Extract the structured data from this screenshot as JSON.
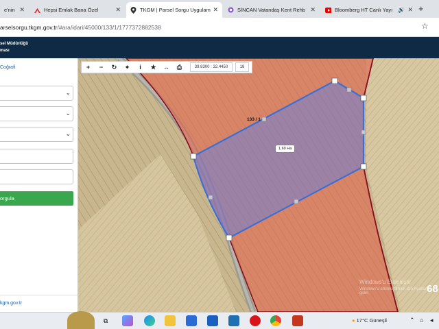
{
  "browser": {
    "tabs": [
      {
        "label": "e'nin",
        "icon": "globe-icon"
      },
      {
        "label": "Hepsi Emlak Bana Özel",
        "icon": "hepsiemlak-icon"
      },
      {
        "label": "TKGM | Parsel Sorgu Uygulam",
        "icon": "map-pin-icon",
        "active": true
      },
      {
        "label": "SİNCAN Vatandaş Kent Rehb",
        "icon": "globe-icon"
      },
      {
        "label": "Bloomberg HT Canlı Yayı",
        "icon": "youtube-icon"
      }
    ],
    "url_host": "arselsorgu.tkgm.gov.tr",
    "url_path": "/#ara/idari/45000/133/1/1777372882538"
  },
  "header": {
    "line1": "sel Müdürlüğü",
    "line2": "ması"
  },
  "panel": {
    "cografi_label": "Coğrafi",
    "query_button_label": "orgula",
    "footer_link": "kgm.gov.tr"
  },
  "map": {
    "coordinates": "39.8300 : 32.4450",
    "zoom_level": "18",
    "parcel_label": "133 / 1",
    "area_label": "1,69 Ha",
    "watermark_line1": "Windows'u Etkinleştir",
    "watermark_line2": "Windows'u etkinleştirmek için Ayarlar'a gidin.",
    "edge_number": "68",
    "colors": {
      "parcel_fill": "#8a6fb0",
      "parcel_stroke": "#3a6fd8",
      "neighbor_fill": "#e06b5a",
      "neighbor_stroke": "#8a0f1e"
    }
  },
  "taskbar": {
    "weather_text": "17°C  Güneşli"
  }
}
